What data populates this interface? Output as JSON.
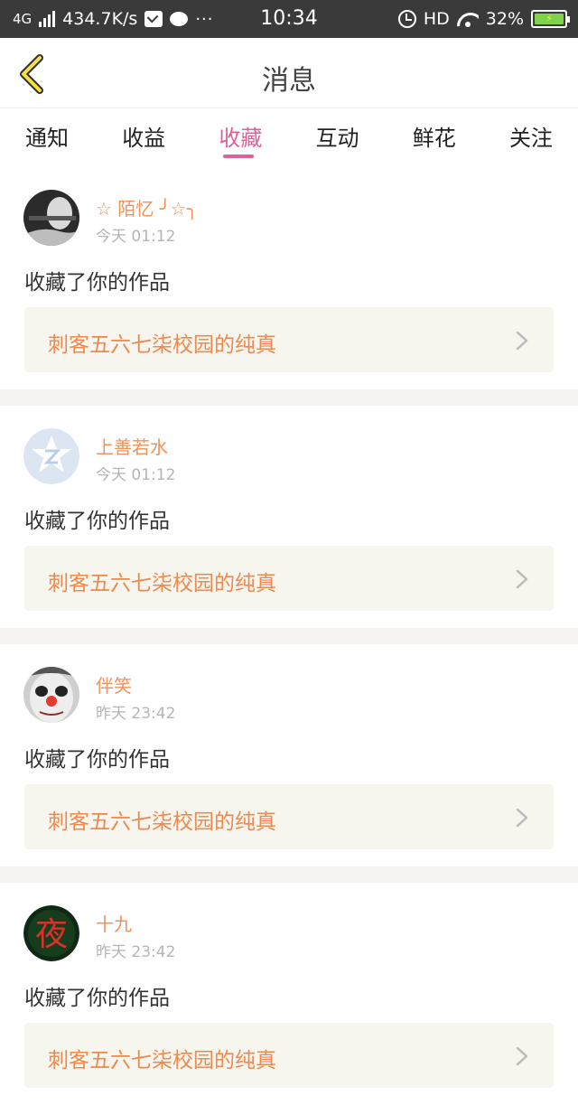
{
  "status_bar": {
    "network": "4G",
    "speed": "434.7K/s",
    "dots": "···",
    "time": "10:34",
    "hd": "HD",
    "battery": "32%"
  },
  "header": {
    "title": "消息"
  },
  "tabs": [
    {
      "label": "通知"
    },
    {
      "label": "收益"
    },
    {
      "label": "收藏"
    },
    {
      "label": "互动"
    },
    {
      "label": "鲜花"
    },
    {
      "label": "关注"
    }
  ],
  "active_tab": "收藏",
  "colors": {
    "accent": "#e0609a",
    "name": "#f0925a",
    "work_title": "#ec8a50",
    "work_bg": "#f6f5ee",
    "separator": "#f7f3f3"
  },
  "messages": [
    {
      "user": "☆ 陌忆 ╯☆╮",
      "time": "今天 01:12",
      "action": "收藏了你的作品",
      "work": "刺客五六七柒校园的纯真",
      "avatar": "dark-photo-avatar"
    },
    {
      "user": "上善若水",
      "time": "今天 01:12",
      "action": "收藏了你的作品",
      "work": "刺客五六七柒校园的纯真",
      "avatar": "default-avatar"
    },
    {
      "user": "伴笑",
      "time": "昨天 23:42",
      "action": "收藏了你的作品",
      "work": "刺客五六七柒校园的纯真",
      "avatar": "clown-face-avatar"
    },
    {
      "user": "十九",
      "time": "昨天 23:42",
      "action": "收藏了你的作品",
      "work": "刺客五六七柒校园的纯真",
      "avatar": "red-character-avatar",
      "avatar_text": "夜"
    }
  ]
}
